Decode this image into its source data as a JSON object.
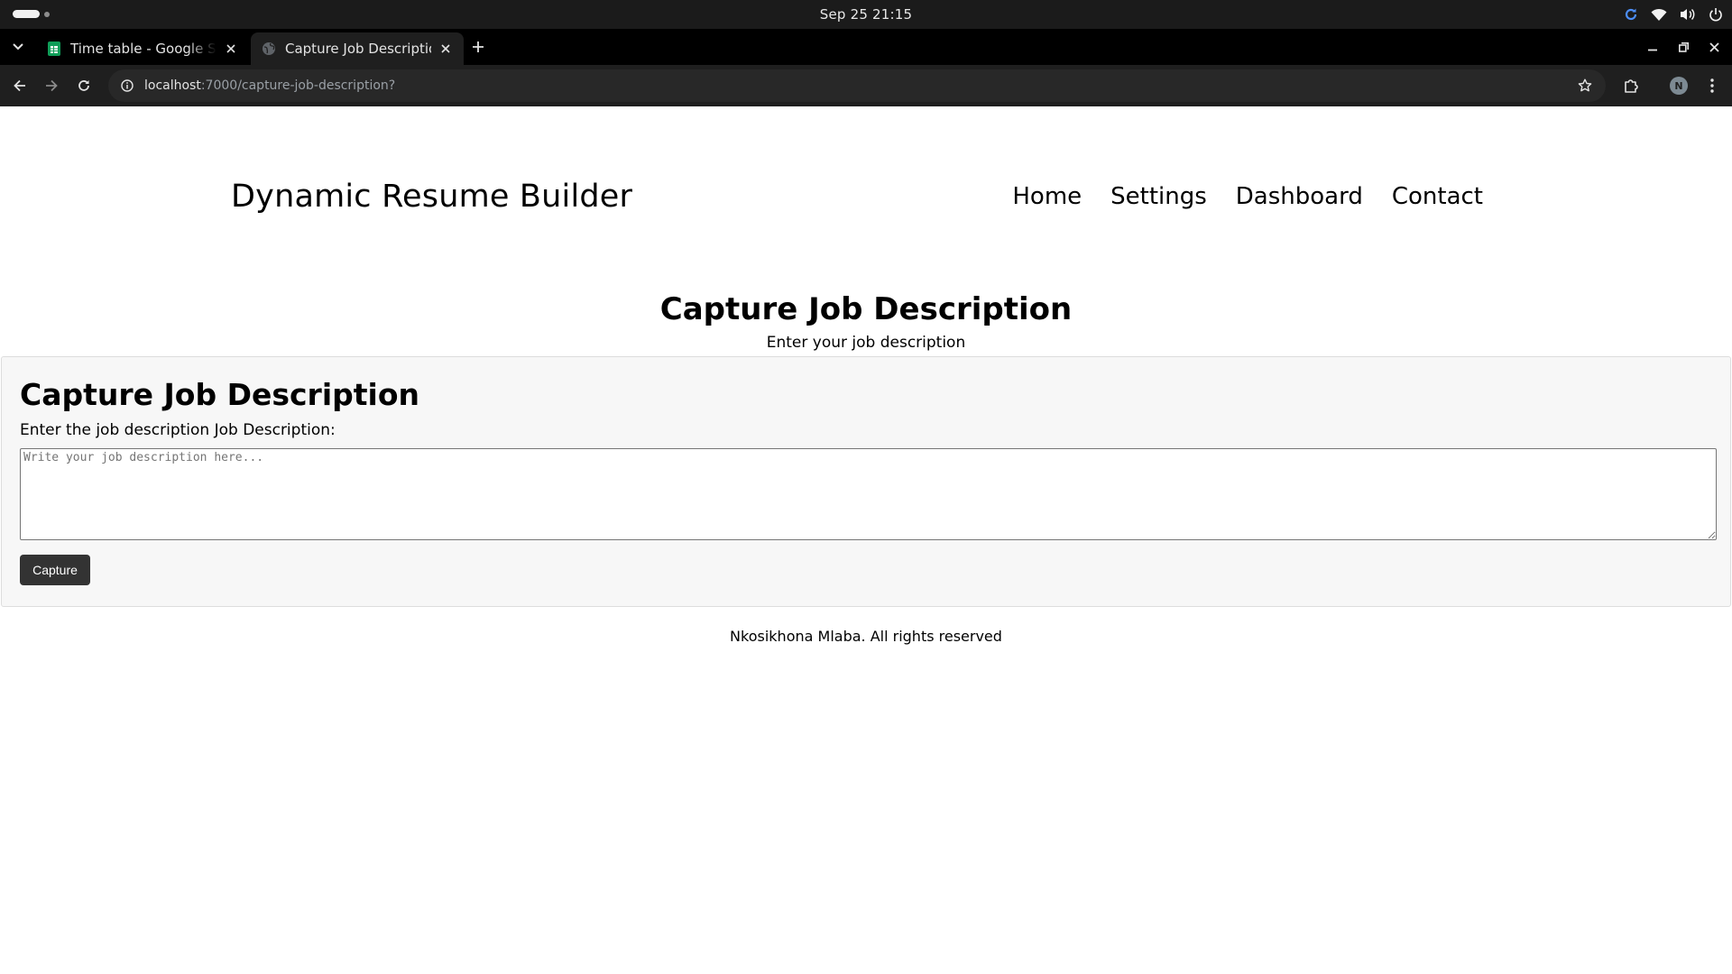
{
  "os": {
    "clock": "Sep 25  21:15"
  },
  "browser": {
    "tabs": [
      {
        "label": "Time table - Google Sheets",
        "icon": "sheets-icon",
        "active": false
      },
      {
        "label": "Capture Job Description",
        "icon": "globe-icon",
        "active": true
      }
    ],
    "url_host": "localhost",
    "url_path": ":7000/capture-job-description?",
    "profile_initial": "N"
  },
  "site": {
    "brand": "Dynamic Resume Builder",
    "nav": [
      "Home",
      "Settings",
      "Dashboard",
      "Contact"
    ]
  },
  "main": {
    "title": "Capture Job Description",
    "subtitle": "Enter your job description"
  },
  "form": {
    "title": "Capture Job Description",
    "label": "Enter the job description Job Description:",
    "textarea_placeholder": "Write your job description here...",
    "textarea_value": "",
    "submit_label": "Capture"
  },
  "footer": {
    "text": "Nkosikhona Mlaba. All rights reserved"
  },
  "colors": {
    "os_bar": "#1b1b1b",
    "tab_strip": "#000000",
    "toolbar": "#1f1f1f",
    "card_bg": "#f7f7f7",
    "button_bg": "#333333"
  }
}
